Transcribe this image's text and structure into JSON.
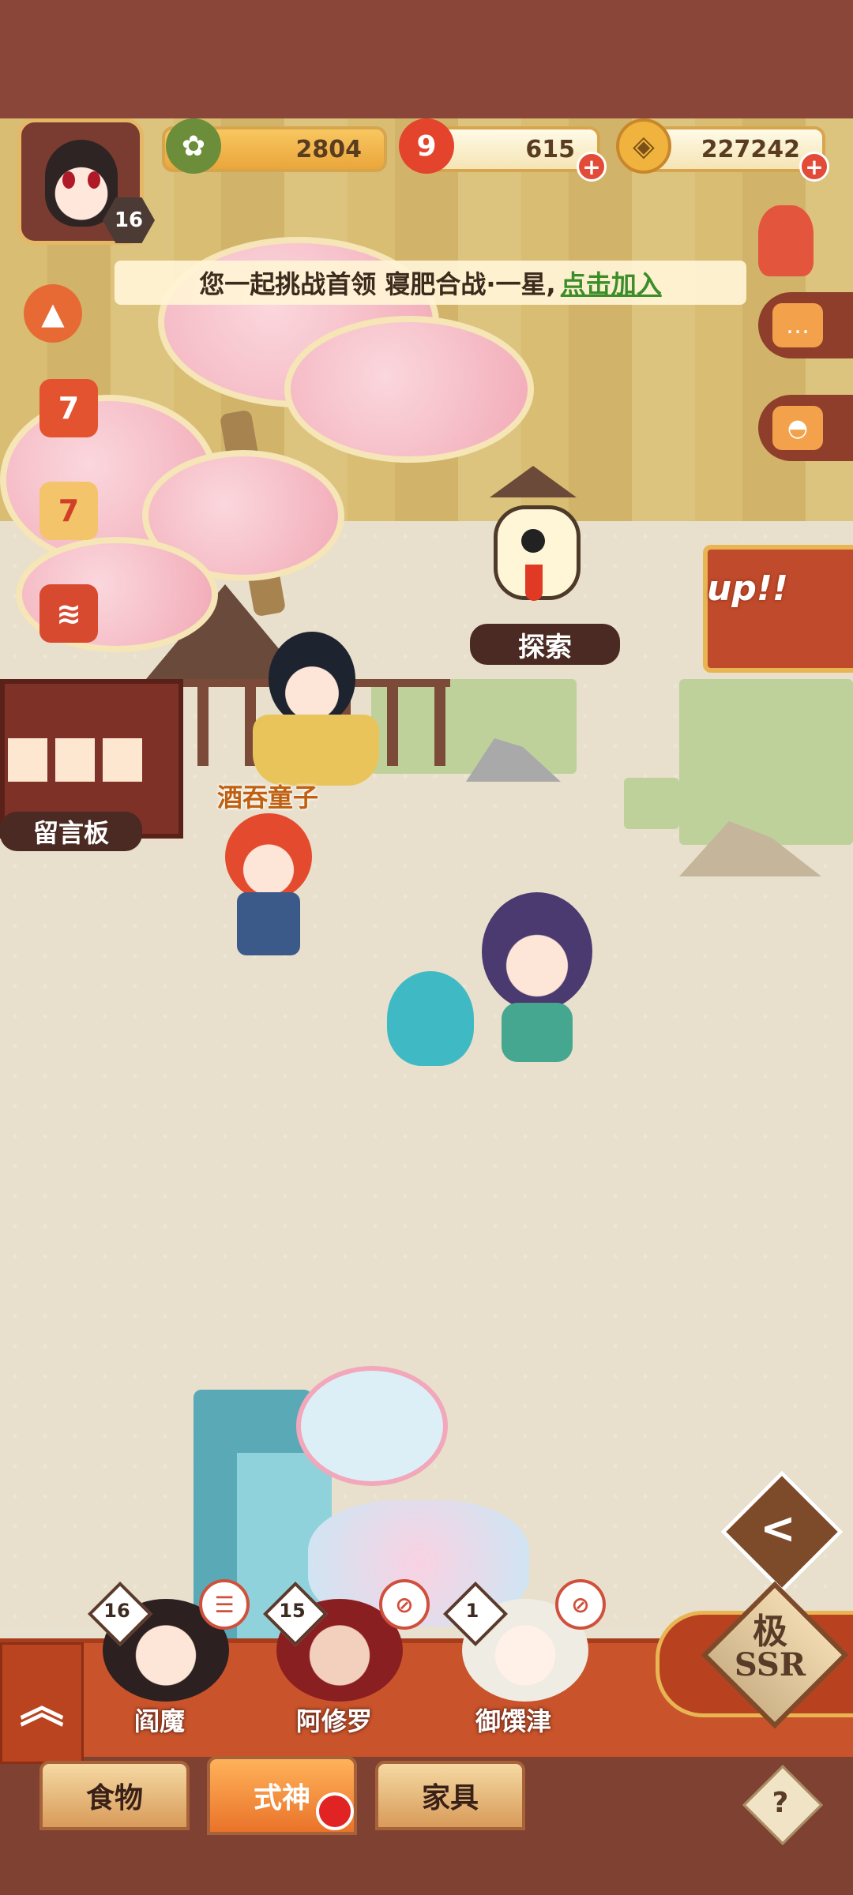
{
  "header": {
    "player_level": "16",
    "currencies": [
      {
        "name": "jade",
        "value": "2804",
        "icon": "pine-icon"
      },
      {
        "name": "magatama",
        "value": "615",
        "icon": "magatama-icon"
      },
      {
        "name": "gold",
        "value": "227242",
        "icon": "coin-icon"
      }
    ],
    "plus": "+"
  },
  "marquee": {
    "text": "您一起挑战首领 寝肥合战·一星,",
    "link": "点击加入"
  },
  "left_side": {
    "calendar_day": "7",
    "event_day": "7"
  },
  "map": {
    "explore_label": "探索",
    "message_board_label": "留言板",
    "character_name": "酒吞童子",
    "up_banner": "up!!"
  },
  "bottom": {
    "expand_glyph": "︽",
    "shikigami": [
      {
        "name": "阎魔",
        "level": "16"
      },
      {
        "name": "阿修罗",
        "level": "15"
      },
      {
        "name": "御馔津",
        "level": "1"
      }
    ],
    "ssr_line1": "极",
    "ssr_line2": "SSR",
    "back_glyph": "<",
    "tabs": [
      {
        "label": "食物",
        "active": false
      },
      {
        "label": "式神",
        "active": true
      },
      {
        "label": "家具",
        "active": false
      }
    ],
    "help_glyph": "?"
  },
  "colors": {
    "accent": "#c9542b",
    "frame": "#8a4638",
    "gold": "#d7a54d"
  }
}
